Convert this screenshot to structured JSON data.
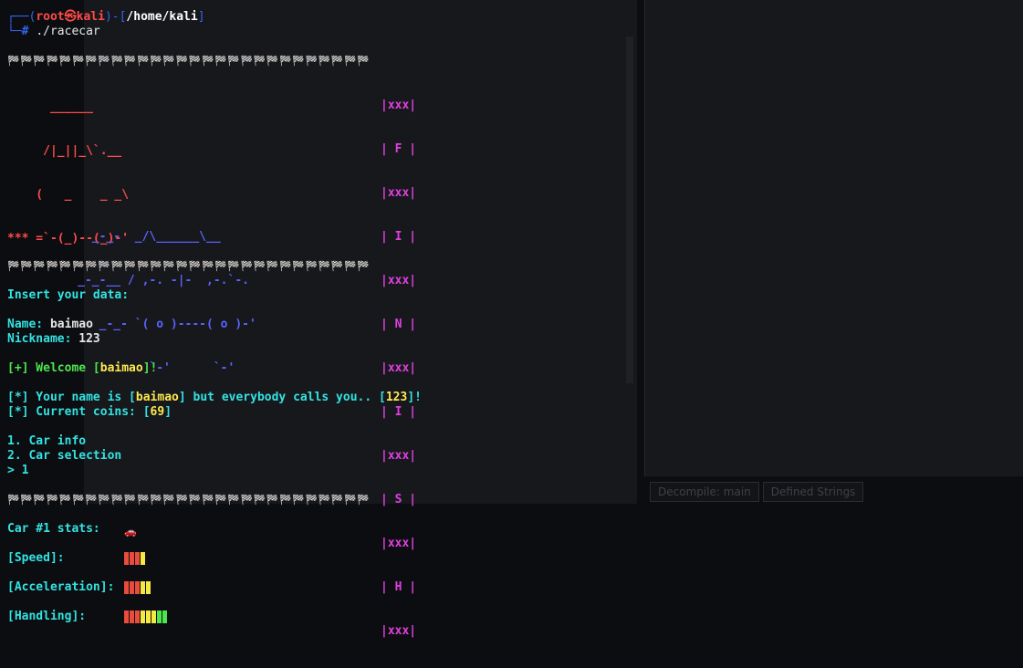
{
  "prompt": {
    "frame_top": "┌──(",
    "user": "root㉿kali",
    "sep": ")-[",
    "dir": "/home/kali",
    "close": "]",
    "frame_bottom": "└─",
    "hash": "#",
    "command": "./racecar"
  },
  "banner": {
    "flag_row": "🏁🏁🏁🏁🏁🏁🏁🏁🏁🏁🏁🏁🏁🏁🏁🏁🏁🏁🏁🏁🏁🏁🏁🏁🏁🏁🏁🏁",
    "red_car": [
      "      ______",
      "     /|_||_\\`.__",
      "    (   _    _ _\\",
      "*** =`-(_)--(_)-'"
    ],
    "blue_car": [
      "       _-_-  _/\\______\\__",
      "     _-_-__ / ,-. -|-  ,-.`-.",
      "        _-_- `( o )----( o )-'",
      "               `-'      `-'"
    ],
    "finish": [
      "|xxx|",
      "| F |",
      "|xxx|",
      "| I |",
      "|xxx|",
      "| N |",
      "|xxx|",
      "| I |",
      "|xxx|",
      "| S |",
      "|xxx|",
      "| H |",
      "|xxx|"
    ]
  },
  "session": {
    "insert_prompt": "Insert your data:",
    "name_label": "Name: ",
    "name_value": "baimao",
    "nickname_label": "Nickname: ",
    "nickname_value": "123",
    "welcome_prefix": "[+] Welcome [",
    "welcome_name": "baimao",
    "welcome_suffix": "]!",
    "info_prefix": "[*] Your name is [",
    "info_name": "baimao",
    "info_mid": "] but everybody calls you.. [",
    "info_nick": "123",
    "info_suffix": "]!",
    "coins_prefix": "[*] Current coins: [",
    "coins_value": "69",
    "coins_suffix": "]",
    "menu_1": "1. Car info",
    "menu_2": "2. Car selection",
    "input_line": "> 1",
    "car_stats_title": "Car #1 stats:",
    "car_icon": "car-icon",
    "speed_label": "[Speed]:",
    "accel_label": "[Acceleration]:",
    "handling_label": "[Handling]:"
  },
  "stats": {
    "speed": [
      "#e74c3c",
      "#e74c3c",
      "#e74c3c",
      "#f4e842"
    ],
    "acceleration": [
      "#e74c3c",
      "#e74c3c",
      "#e74c3c",
      "#f4e842",
      "#f4e842"
    ],
    "handling": [
      "#e74c3c",
      "#e74c3c",
      "#e74c3c",
      "#f4e842",
      "#f4e842",
      "#f4e842",
      "#4ee44e",
      "#4ee44e"
    ]
  },
  "background": {
    "decomp_tab_1": "Decompile: main",
    "decomp_tab_2": "Defined Strings"
  }
}
